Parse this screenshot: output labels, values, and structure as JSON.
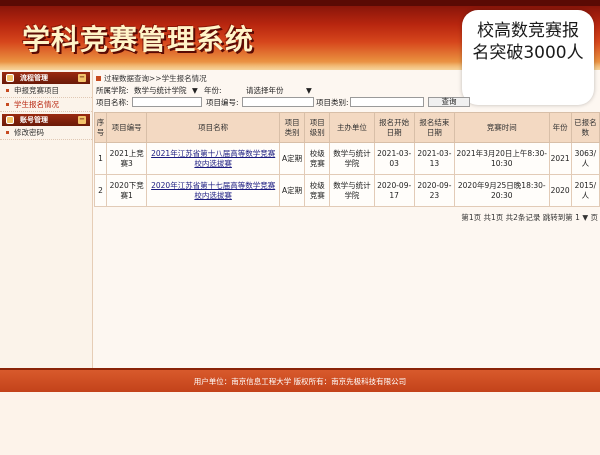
{
  "app": {
    "title": "学科竞赛管理系统"
  },
  "overlay": {
    "text": "校高数竞赛报名突破3000人"
  },
  "sidebar": {
    "sections": [
      {
        "label": "流程管理",
        "items": [
          "申报竞赛项目",
          "学生报名情况"
        ]
      },
      {
        "label": "账号管理",
        "items": [
          "修改密码"
        ]
      }
    ]
  },
  "breadcrumb": "过程数据查询>>学生报名情况",
  "filters": {
    "college_label": "所属学院:",
    "college_value": "数学与统计学院",
    "year_label": "年份:",
    "year_value": "请选择年份",
    "project_name_label": "项目名称:",
    "project_code_label": "项目编号:",
    "project_type_label": "项目类别:",
    "query_button": "查询"
  },
  "table": {
    "headers": [
      "序号",
      "项目编号",
      "项目名称",
      "项目类别",
      "项目级别",
      "主办单位",
      "报名开始日期",
      "报名结束日期",
      "竞赛时间",
      "年份",
      "已报名数"
    ],
    "rows": [
      [
        "1",
        "2021上竞赛3",
        "2021年江苏省第十八届高等数学竞赛校内选拔赛",
        "A定期",
        "校级竞赛",
        "数学与统计学院",
        "2021-03-03",
        "2021-03-13",
        "2021年3月20日上午8:30-10:30",
        "2021",
        "3063/人"
      ],
      [
        "2",
        "2020下竞赛1",
        "2020年江苏省第十七届高等数学竞赛校内选拔赛",
        "A定期",
        "校级竞赛",
        "数学与统计学院",
        "2020-09-17",
        "2020-09-23",
        "2020年9月25日晚18:30-20:30",
        "2020",
        "2015/人"
      ]
    ]
  },
  "pager": {
    "text": "第1页 共1页 共2条记录 跳转到第 1 ▼ 页"
  },
  "footer": {
    "text": "用户单位：南京信息工程大学    版权所有：南京先极科技有限公司"
  }
}
